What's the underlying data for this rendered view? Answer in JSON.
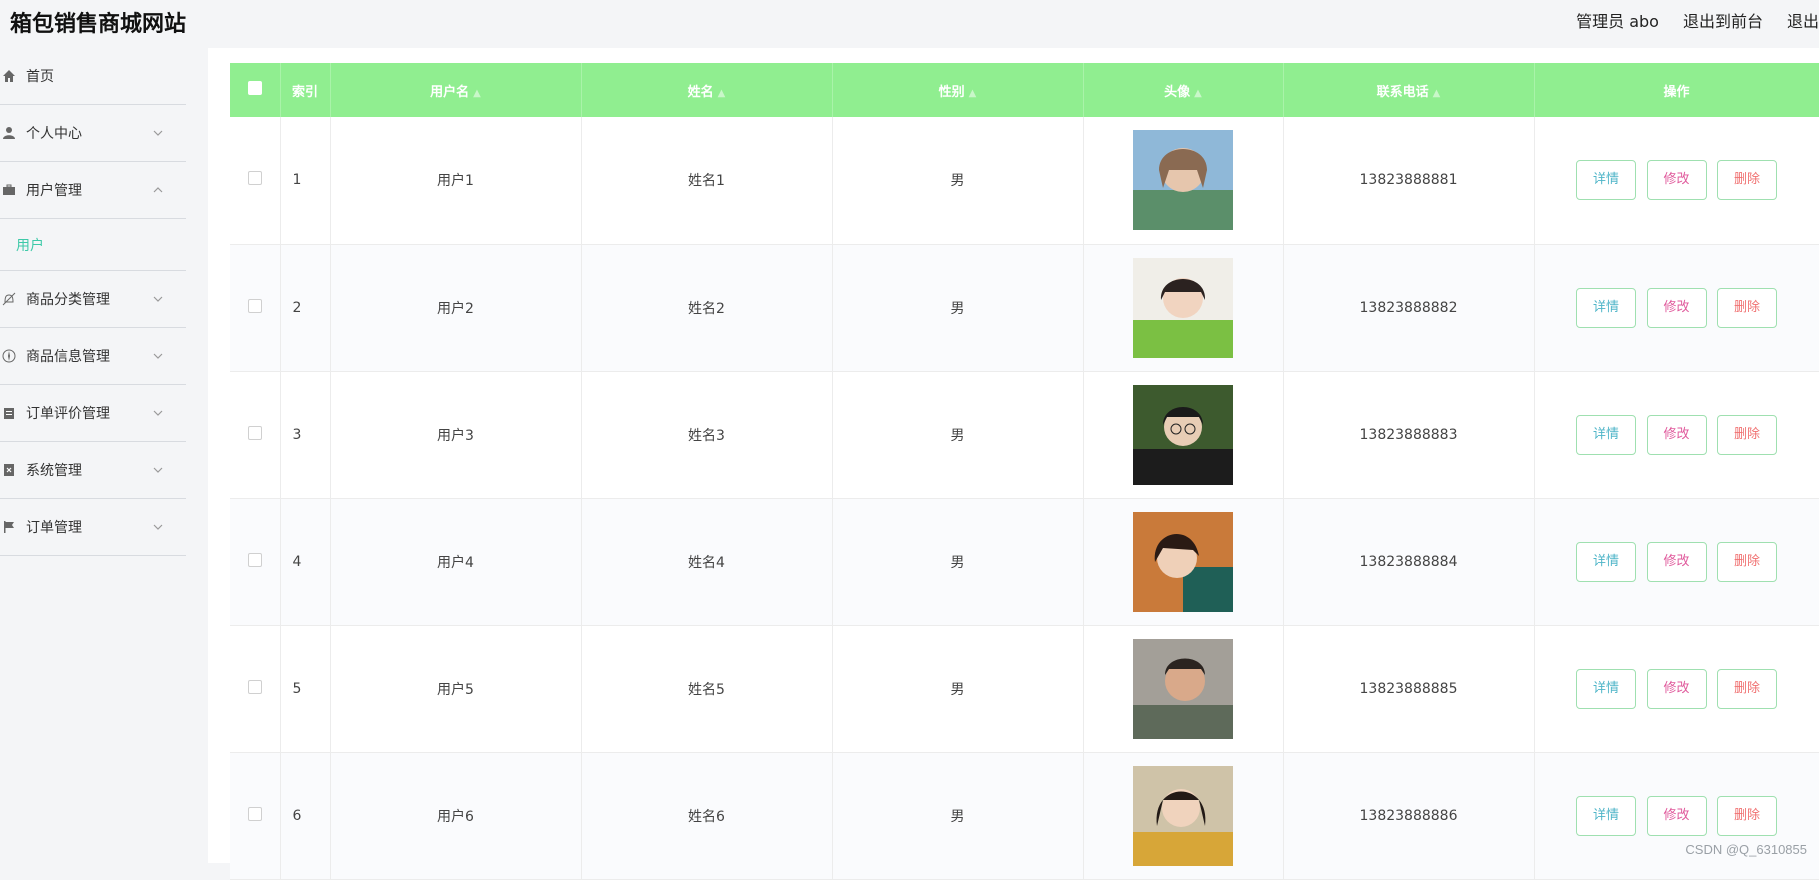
{
  "header": {
    "site_title": "箱包销售商城网站",
    "admin_label": "管理员 abo",
    "to_front_label": "退出到前台",
    "logout_label": "退出"
  },
  "sidebar": {
    "items": [
      {
        "label": "首页",
        "icon": "home-icon"
      },
      {
        "label": "个人中心",
        "icon": "user-icon"
      },
      {
        "label": "用户管理",
        "icon": "briefcase-icon",
        "expanded": true
      },
      {
        "label": "商品分类管理",
        "icon": "bell-off-icon"
      },
      {
        "label": "商品信息管理",
        "icon": "compass-icon"
      },
      {
        "label": "订单评价管理",
        "icon": "clipboard-icon"
      },
      {
        "label": "系统管理",
        "icon": "document-x-icon"
      },
      {
        "label": "订单管理",
        "icon": "flag-icon"
      }
    ],
    "submenu_active": "用户"
  },
  "table": {
    "headers": [
      "索引",
      "用户名",
      "姓名",
      "性别",
      "头像",
      "联系电话",
      "操作"
    ],
    "rows": [
      {
        "index": "1",
        "username": "用户1",
        "name": "姓名1",
        "gender": "男",
        "phone": "13823888881"
      },
      {
        "index": "2",
        "username": "用户2",
        "name": "姓名2",
        "gender": "男",
        "phone": "13823888882"
      },
      {
        "index": "3",
        "username": "用户3",
        "name": "姓名3",
        "gender": "男",
        "phone": "13823888883"
      },
      {
        "index": "4",
        "username": "用户4",
        "name": "姓名4",
        "gender": "男",
        "phone": "13823888884"
      },
      {
        "index": "5",
        "username": "用户5",
        "name": "姓名5",
        "gender": "男",
        "phone": "13823888885"
      },
      {
        "index": "6",
        "username": "用户6",
        "name": "姓名6",
        "gender": "男",
        "phone": "13823888886"
      }
    ],
    "actions": {
      "detail": "详情",
      "edit": "修改",
      "delete": "删除"
    }
  },
  "colors": {
    "header_bg": "#90ee90",
    "active_submenu": "#3ec9a8"
  },
  "watermark": "CSDN @Q_6310855"
}
